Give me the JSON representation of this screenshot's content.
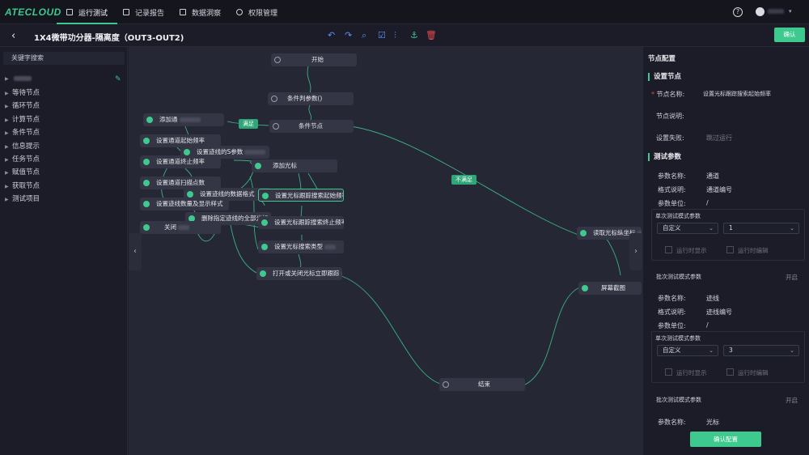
{
  "app": {
    "logo": "ATECLOUD"
  },
  "nav": [
    {
      "label": "运行测试",
      "icon": "monitor-icon"
    },
    {
      "label": "记录报告",
      "icon": "report-icon"
    },
    {
      "label": "数据洞察",
      "icon": "chart-icon"
    },
    {
      "label": "权限管理",
      "icon": "gear-icon"
    }
  ],
  "header": {
    "title": "1X4微带功分器-隔离度（OUT3-OUT2)",
    "confirm": "确认",
    "help": "?"
  },
  "left": {
    "search_placeholder": "关键字搜索",
    "items": [
      "等待节点",
      "循环节点",
      "计算节点",
      "条件节点",
      "信息提示",
      "任务节点",
      "赋值节点",
      "获取节点",
      "测试项目"
    ]
  },
  "canvas": {
    "nodes": {
      "start": "开始",
      "cond_param": "条件判参数()",
      "cond_node": "条件节点",
      "add_channel": "添加通",
      "set_ch_start": "设置通道起始频率",
      "set_trace_s": "设置迹线的S参数",
      "set_ch_stop": "设置通道终止频率",
      "add_marker": "添加光标",
      "set_ch_points": "设置通道扫描点数",
      "set_trace_fmt": "设置迹线的数据格式",
      "set_marker_start": "设置光标跟踪搜索起始频率",
      "set_trace_count": "设置迹线数量及显示样式",
      "delete_traces": "删除指定迹线的全部光标",
      "set_marker_stop": "设置光标跟踪搜索终止频率",
      "close_all": "关闭",
      "set_marker_type": "设置光标搜索类型",
      "toggle_marker": "打开或关闭光标立即跟踪",
      "read_marker": "读取光标纵坐标",
      "screenshot": "屏幕截图",
      "end": "结束"
    },
    "tags": {
      "satisfied": "满足",
      "not_satisfied": "不满足"
    }
  },
  "panel": {
    "title": "节点配置",
    "node_settings": "设置节点",
    "node_name_label": "节点名称:",
    "node_name_value": "设置光标跟踪搜索起始频率",
    "node_desc_label": "节点说明:",
    "fail_label": "设置失败:",
    "fail_value": "跳过运行",
    "test_params": "测试参数",
    "param1": {
      "name_label": "参数名称:",
      "name": "通道",
      "fmt_label": "格式说明:",
      "fmt": "通道编号",
      "unit_label": "参数单位:",
      "unit": "/"
    },
    "single_mode": "单次测试模式参数",
    "select1": {
      "mode": "自定义",
      "value": "1"
    },
    "run_show": "运行时显示",
    "run_edit": "运行时编辑",
    "batch_mode": "批次测试模式参数",
    "enable": "开启",
    "param2": {
      "name": "迹线",
      "fmt": "迹线编号",
      "unit": "/"
    },
    "select2": {
      "mode": "自定义",
      "value": "3"
    },
    "param3": {
      "name": "光标"
    },
    "confirm_config": "确认配置"
  }
}
